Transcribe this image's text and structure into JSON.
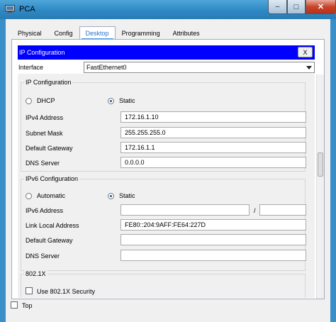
{
  "window": {
    "title": "PCA",
    "min_symbol": "‒",
    "max_symbol": "□",
    "close_symbol": "✕"
  },
  "tabs": [
    {
      "label": "Physical"
    },
    {
      "label": "Config"
    },
    {
      "label": "Desktop",
      "active": true
    },
    {
      "label": "Programming"
    },
    {
      "label": "Attributes"
    }
  ],
  "ip_config": {
    "header": "IP Configuration",
    "close_label": "X",
    "interface_label": "Interface",
    "interface_value": "FastEthernet0",
    "ipv4": {
      "group_title": "IP Configuration",
      "dhcp_label": "DHCP",
      "static_label": "Static",
      "mode": "Static",
      "address_label": "IPv4 Address",
      "address": "172.16.1.10",
      "mask_label": "Subnet Mask",
      "mask": "255.255.255.0",
      "gateway_label": "Default Gateway",
      "gateway": "172.16.1.1",
      "dns_label": "DNS Server",
      "dns": "0.0.0.0"
    },
    "ipv6": {
      "group_title": "IPv6 Configuration",
      "auto_label": "Automatic",
      "static_label": "Static",
      "mode": "Static",
      "address_label": "IPv6 Address",
      "address": "",
      "prefix_sep": "/",
      "prefix": "",
      "link_local_label": "Link Local Address",
      "link_local": "FE80::204:9AFF:FE64:227D",
      "gateway_label": "Default Gateway",
      "gateway": "",
      "dns_label": "DNS Server",
      "dns": ""
    },
    "dot1x": {
      "group_title": "802.1X",
      "use_label": "Use 802.1X Security",
      "checked": false
    }
  },
  "footer": {
    "top_label": "Top",
    "top_checked": false
  },
  "colors": {
    "header_blue": "#0000ff",
    "active_tab_text": "#2a6fc9",
    "titlebar": "#3a8fc8"
  }
}
